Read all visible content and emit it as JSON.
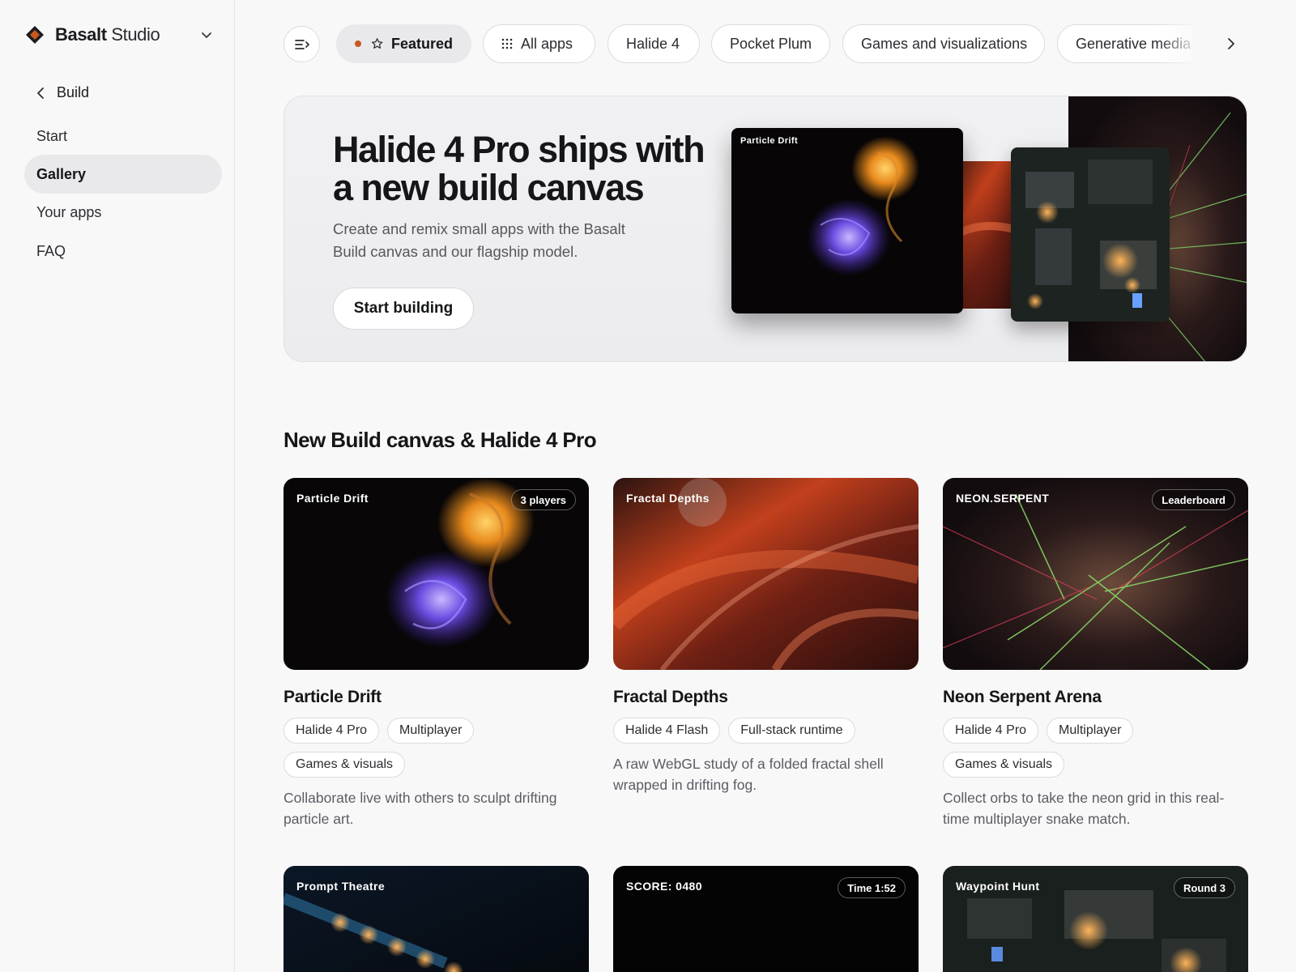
{
  "brand": {
    "name_bold": "Basalt",
    "name_light": "Studio"
  },
  "sidebar": {
    "back_label": "Build",
    "items": [
      {
        "label": "Start",
        "active": false
      },
      {
        "label": "Gallery",
        "active": true
      },
      {
        "label": "Your apps",
        "active": false
      },
      {
        "label": "FAQ",
        "active": false
      }
    ]
  },
  "chips": {
    "featured": "Featured",
    "all_apps": "All apps",
    "halide4": "Halide 4",
    "pocket_plum": "Pocket Plum",
    "games": "Games and visualizations",
    "generative": "Generative media"
  },
  "hero": {
    "title": "Halide 4 Pro ships with a new build canvas",
    "description": "Create and remix small apps with the Basalt Build canvas and our flagship model.",
    "button": "Start building",
    "preview_label": "Particle Drift"
  },
  "section": {
    "title": "New Build canvas & Halide 4 Pro"
  },
  "cards": [
    {
      "thumb_label": "Particle Drift",
      "badge": "3 players",
      "title": "Particle Drift",
      "tags": [
        "Halide 4 Pro",
        "Multiplayer",
        "Games & visuals"
      ],
      "description": "Collaborate live with others to sculpt drifting particle art."
    },
    {
      "thumb_label": "Fractal Depths",
      "title": "Fractal Depths",
      "tags": [
        "Halide 4 Flash",
        "Full-stack runtime"
      ],
      "description": "A raw WebGL study of a folded fractal shell wrapped in drifting fog."
    },
    {
      "thumb_label": "NEON.SERPENT",
      "badge": "Leaderboard",
      "title": "Neon Serpent Arena",
      "tags": [
        "Halide 4 Pro",
        "Multiplayer",
        "Games & visuals"
      ],
      "description": "Collect orbs to take the neon grid in this real-time multiplayer snake match."
    },
    {
      "thumb_label": "Prompt Theatre"
    },
    {
      "thumb_label": "SCORE: 0480",
      "badge": "Time 1:52"
    },
    {
      "thumb_label": "Waypoint Hunt",
      "badge": "Round 3"
    }
  ],
  "colors": {
    "accent_dot": "#c8581e",
    "selected_chip": "#e9e9ec",
    "page_bg": "#f8f8f9"
  },
  "icons": [
    "diamond-logo-icon",
    "chevron-down-icon",
    "chevron-left-icon",
    "sidebar-toggle-icon",
    "star-icon",
    "grid-icon",
    "chevron-right-icon"
  ]
}
